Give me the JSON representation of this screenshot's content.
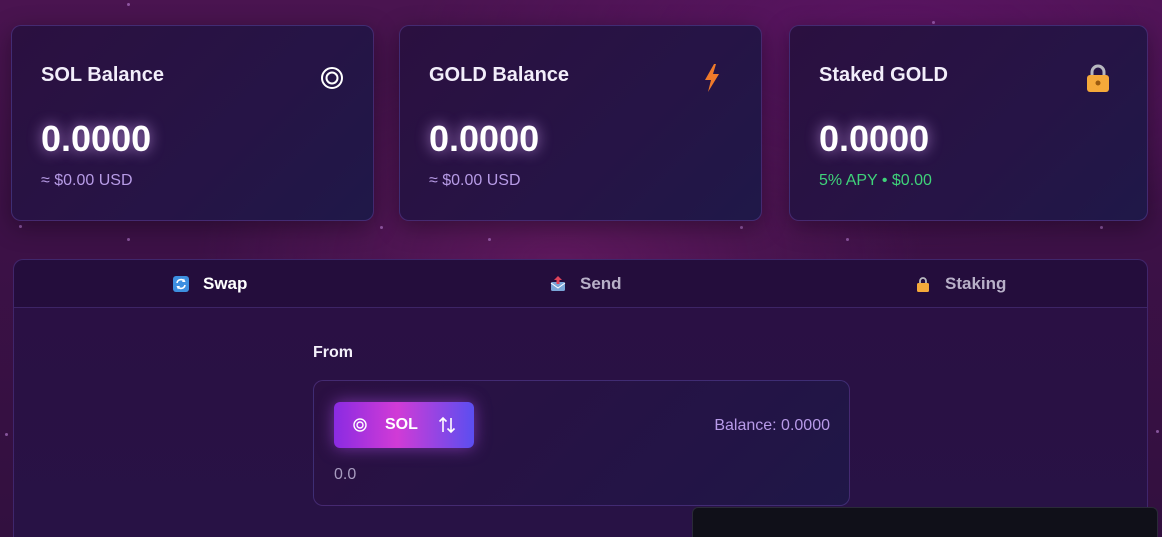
{
  "cards": [
    {
      "title": "SOL Balance",
      "value": "0.0000",
      "sub": "≈ $0.00 USD",
      "icon": "sol-ring-icon"
    },
    {
      "title": "GOLD Balance",
      "value": "0.0000",
      "sub": "≈ $0.00 USD",
      "icon": "lightning-icon"
    },
    {
      "title": "Staked GOLD",
      "value": "0.0000",
      "sub": "5% APY • $0.00",
      "icon": "lock-icon"
    }
  ],
  "tabs": [
    {
      "label": "Swap",
      "icon": "swap-icon",
      "active": true
    },
    {
      "label": "Send",
      "icon": "send-icon",
      "active": false
    },
    {
      "label": "Staking",
      "icon": "lock-icon",
      "active": false
    }
  ],
  "swap": {
    "from_label": "From",
    "token": "SOL",
    "balance": "Balance: 0.0000",
    "amount_placeholder": "0.0"
  },
  "colors": {
    "accent_purple": "#8a2be2",
    "accent_pink": "#d13bd6",
    "apy_green": "#3fd27a",
    "sub_purple": "#b79be6"
  }
}
